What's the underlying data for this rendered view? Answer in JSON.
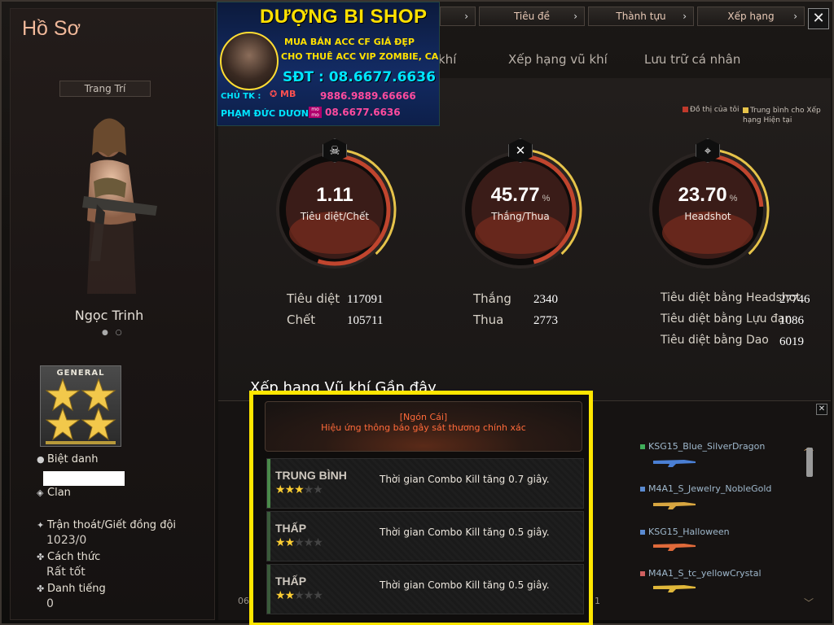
{
  "left": {
    "title": "Hồ Sơ",
    "decorate_btn": "Trang Trí",
    "character_name": "Ngọc Trinh",
    "rank_label": "GENERAL",
    "nickname_label": "Biệt danh",
    "clan_label": "Clan",
    "escape_label": "Trận thoát/Giết đồng đội",
    "escape_value": "1023/0",
    "manner_label": "Cách thức",
    "manner_value": "Rất tốt",
    "reputation_label": "Danh tiếng",
    "reputation_value": "0"
  },
  "tabs": [
    {
      "label": "Tiêu đề"
    },
    {
      "label": "Thành tựu"
    },
    {
      "label": "Xếp hạng"
    }
  ],
  "subtabs": {
    "weapon_rank": "Xếp hạng vũ khí",
    "storage": "Lưu trữ cá nhân"
  },
  "legend": {
    "mine": "Đồ thị của tôi",
    "avg": "Trung bình cho Xếp hạng Hiện tại"
  },
  "gauges": [
    {
      "value": "1.11",
      "caption": "Tiêu diệt/Chết",
      "icon": "skull-icon",
      "fill": 0.55
    },
    {
      "value": "45.77",
      "unit": "%",
      "caption": "Thắng/Thua",
      "icon": "crossed-guns-icon",
      "fill": 0.46
    },
    {
      "value": "23.70",
      "unit": "%",
      "caption": "Headshot",
      "icon": "crosshair-gun-icon",
      "fill": 0.24
    }
  ],
  "stats": {
    "kills_label": "Tiêu diệt",
    "kills": "117091",
    "deaths_label": "Chết",
    "deaths": "105711",
    "wins_label": "Thắng",
    "wins": "2340",
    "losses_label": "Thua",
    "losses": "2773",
    "hs_label": "Tiêu diệt bằng Headshot",
    "hs": "27746",
    "grenade_label": "Tiêu diệt bằng Lựu đạn",
    "grenade": "1086",
    "knife_label": "Tiêu diệt bằng Dao",
    "knife": "6019"
  },
  "recent": {
    "title": "Xếp hạng Vũ khí Gần đây",
    "weapons": [
      {
        "name": "KSG15_Blue_SilverDragon",
        "color": "#3fae5a"
      },
      {
        "name": "M4A1_S_Jewelry_NobleGold",
        "color": "#5a8ad0"
      },
      {
        "name": "KSG15_Halloween",
        "color": "#5a8ad0"
      },
      {
        "name": "M4A1_S_tc_yellowCrystal",
        "color": "#d06060"
      }
    ],
    "pager_left": "06",
    "pager_right": "1"
  },
  "popup": {
    "head_line1": "[Ngón Cái]",
    "head_line2": "Hiệu ứng thông báo gây sát thương chính xác",
    "rows": [
      {
        "tier": "TRUNG BÌNH",
        "stars": 3,
        "desc": "Thời gian Combo Kill tăng 0.7 giây."
      },
      {
        "tier": "THẤP",
        "stars": 2,
        "desc": "Thời gian Combo Kill tăng 0.5 giây."
      },
      {
        "tier": "THẤP",
        "stars": 2,
        "desc": "Thời gian Combo Kill tăng 0.5 giây."
      }
    ]
  },
  "shop": {
    "name": "DƯỢNG BI SHOP",
    "line1": "MUA BÁN ACC CF GIÁ ĐẸP",
    "line2": "CHO THUÊ ACC VIP ZOMBIE, CA",
    "phone": "SĐT : 08.6677.6636",
    "owner_label": "CHỦ TK :",
    "bank": "MB",
    "bank_acc": "9886.9889.66666",
    "owner_name": "PHẠM ĐỨC DƯƠNG",
    "momo_label": "mo mo",
    "momo_phone": "08.6677.6636"
  }
}
